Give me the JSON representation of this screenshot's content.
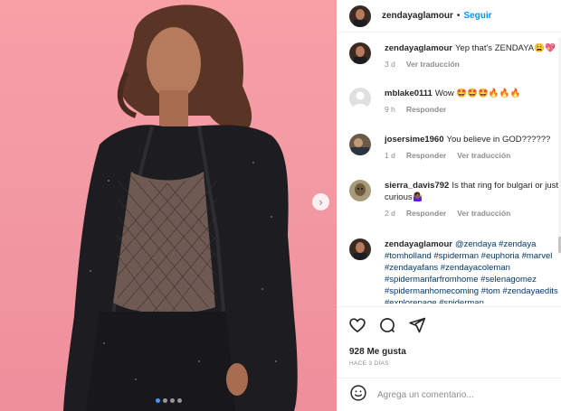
{
  "post": {
    "author": "zendayaglamour",
    "follow_label": "Seguir",
    "likes": "928 Me gusta",
    "time_ago": "HACE 3 DÍAS",
    "comment_placeholder": "Agrega un comentario...",
    "carousel": {
      "total": 4,
      "active_index": 1
    }
  },
  "comments": [
    {
      "user": "zendayaglamour",
      "text": "Yep that's ZENDAYA😩💖",
      "age": "3 d",
      "reply": "",
      "translate": "Ver traducción"
    },
    {
      "user": "mblake0111",
      "text": "Wow 🤩🤩🤩🔥🔥🔥",
      "age": "9 h",
      "reply": "Responder",
      "translate": ""
    },
    {
      "user": "josersime1960",
      "text": "You believe in GOD??????",
      "age": "1 d",
      "reply": "Responder",
      "translate": "Ver traducción"
    },
    {
      "user": "sierra_davis792",
      "text": "Is that ring for bulgari or just curious🤷🏾‍♀️",
      "age": "2 d",
      "reply": "Responder",
      "translate": "Ver traducción"
    },
    {
      "user": "zendayaglamour",
      "text": "@zendaya #zendaya #tomholland #spiderman #euphoria #marvel #zendayafans #zendayacoleman #spidermanfarfromhome #selenagomez #spidermanhomecoming #tom #zendayaedits #explorepage #spiderman",
      "age": "",
      "reply": "",
      "translate": ""
    }
  ],
  "colors": {
    "accent": "#0095f6",
    "background_pink": "#f39aa3",
    "hashtag": "#00376b",
    "muted": "#8e8e8e"
  },
  "icons": {
    "like": "heart-icon",
    "comment": "comment-icon",
    "share": "paper-plane-icon",
    "emoji": "smiley-icon",
    "next": "chevron-right-icon"
  }
}
